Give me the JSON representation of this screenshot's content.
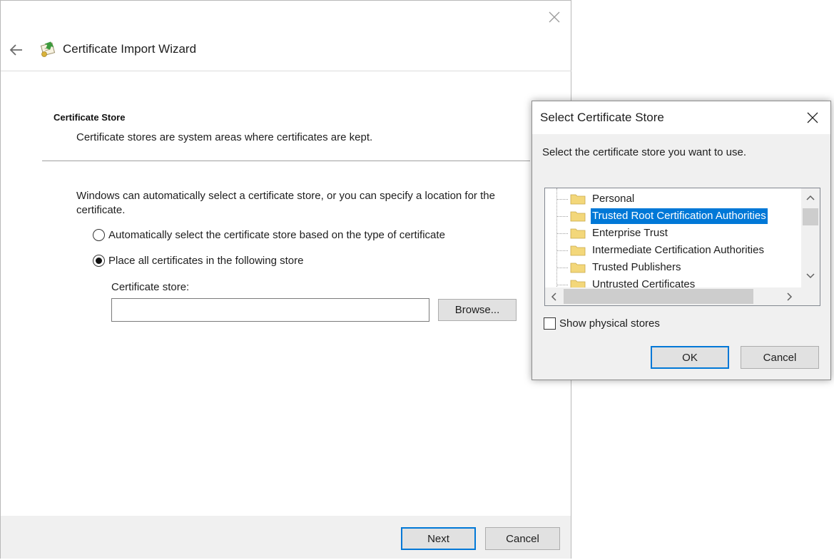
{
  "wizard": {
    "title": "Certificate Import Wizard",
    "section_title": "Certificate Store",
    "section_desc": "Certificate stores are system areas where certificates are kept.",
    "intro_text": "Windows can automatically select a certificate store, or you can specify a location for the certificate.",
    "options": [
      {
        "label": "Automatically select the certificate store based on the type of certificate",
        "selected": false
      },
      {
        "label": "Place all certificates in the following store",
        "selected": true
      }
    ],
    "store_label": "Certificate store:",
    "store_value": "",
    "browse_label": "Browse...",
    "next_label": "Next",
    "cancel_label": "Cancel"
  },
  "dialog": {
    "title": "Select Certificate Store",
    "prompt": "Select the certificate store you want to use.",
    "stores": [
      {
        "label": "Personal",
        "selected": false
      },
      {
        "label": "Trusted Root Certification Authorities",
        "selected": true
      },
      {
        "label": "Enterprise Trust",
        "selected": false
      },
      {
        "label": "Intermediate Certification Authorities",
        "selected": false
      },
      {
        "label": "Trusted Publishers",
        "selected": false
      },
      {
        "label": "Untrusted Certificates",
        "selected": false
      }
    ],
    "show_physical_label": "Show physical stores",
    "show_physical_checked": false,
    "ok_label": "OK",
    "cancel_label": "Cancel"
  },
  "colors": {
    "accent": "#0078d7",
    "folder": "#f3d77a"
  }
}
